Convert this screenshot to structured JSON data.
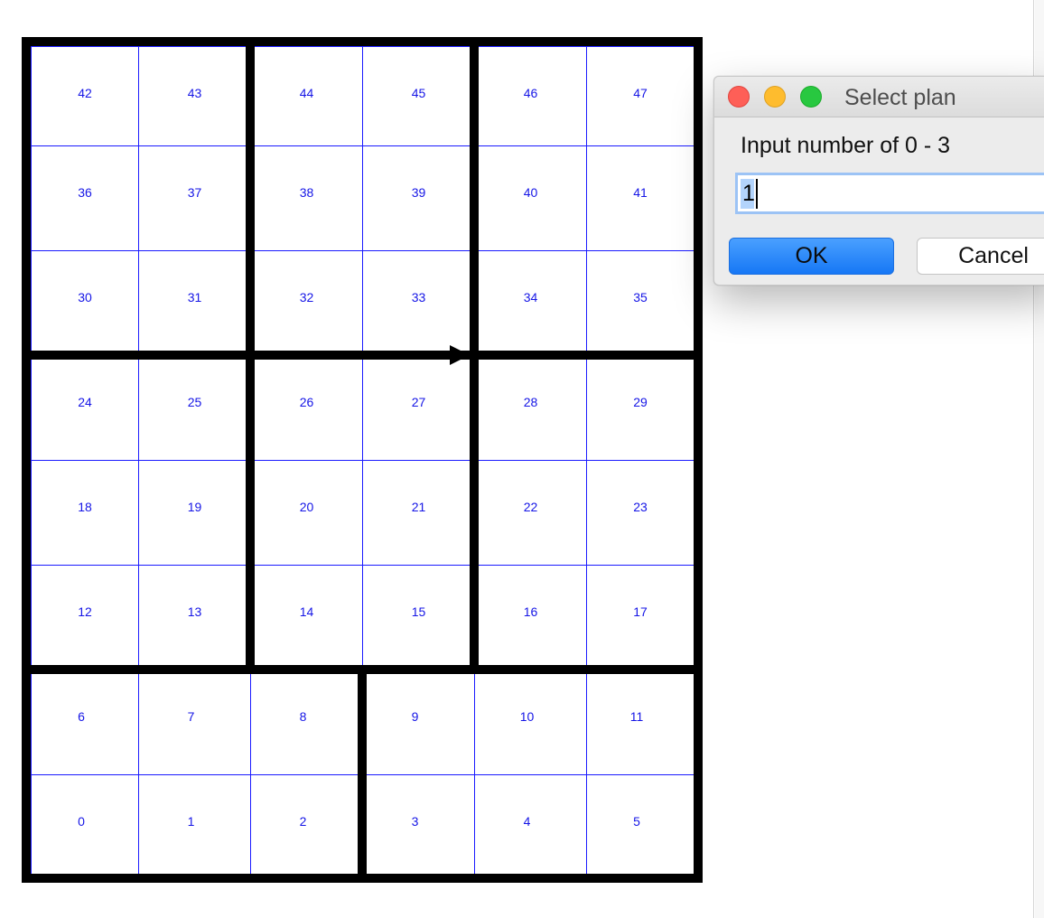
{
  "board": {
    "rows": [
      [
        "42",
        "43",
        "44",
        "45",
        "46",
        "47"
      ],
      [
        "36",
        "37",
        "38",
        "39",
        "40",
        "41"
      ],
      [
        "30",
        "31",
        "32",
        "33",
        "34",
        "35"
      ],
      [
        "24",
        "25",
        "26",
        "27",
        "28",
        "29"
      ],
      [
        "18",
        "19",
        "20",
        "21",
        "22",
        "23"
      ],
      [
        "12",
        "13",
        "14",
        "15",
        "16",
        "17"
      ],
      [
        "6",
        "7",
        "8",
        "9",
        "10",
        "11"
      ],
      [
        "0",
        "1",
        "2",
        "3",
        "4",
        "5"
      ]
    ],
    "colors": {
      "grid_line": "#1a1aff",
      "cell_text": "#1515e6",
      "block_border": "#000000"
    }
  },
  "dialog": {
    "title": "Select plan",
    "prompt": "Input number of 0 - 3",
    "input_value": "1",
    "ok_label": "OK",
    "cancel_label": "Cancel",
    "window_controls": [
      "close-icon",
      "minimize-icon",
      "maximize-icon"
    ]
  }
}
